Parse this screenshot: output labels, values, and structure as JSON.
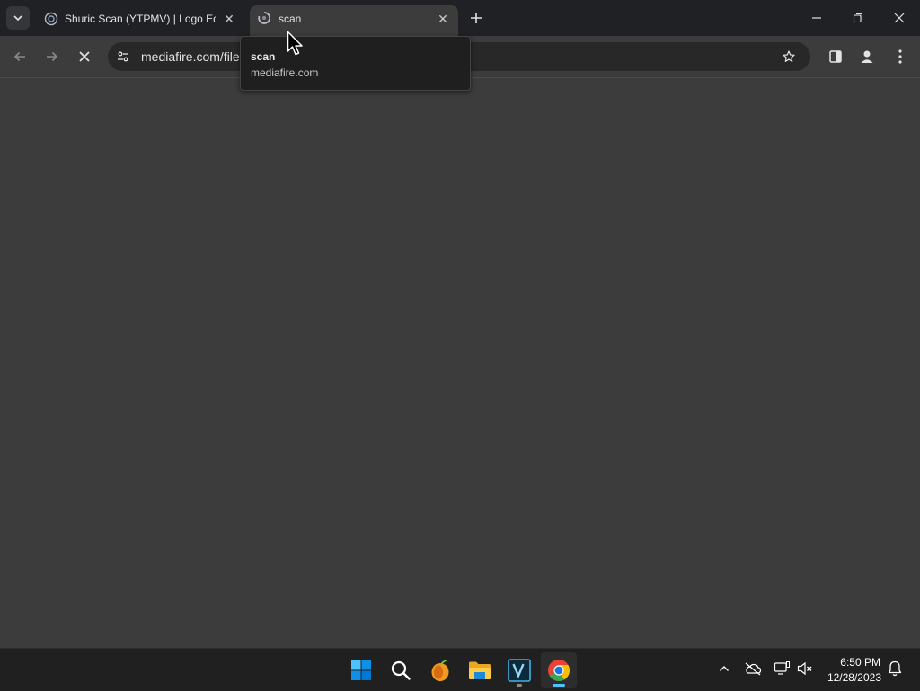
{
  "browser": {
    "tabs": [
      {
        "title": "Shuric Scan (YTPMV) | Logo Edi",
        "active": false
      },
      {
        "title": "scan",
        "active": true
      }
    ],
    "address": {
      "url": "mediafire.com/file"
    },
    "hover_card": {
      "title": "scan",
      "domain": "mediafire.com"
    }
  },
  "taskbar": {
    "apps": [
      "windows-start",
      "search",
      "fl-studio",
      "file-explorer",
      "vegas-pro",
      "google-chrome"
    ],
    "clock": {
      "time": "6:50 PM",
      "date": "12/28/2023"
    }
  },
  "colors": {
    "tab_strip": "#202124",
    "toolbar": "#3c3c3c",
    "page": "#3c3c3c",
    "taskbar": "#202020",
    "chrome_indicator": "#4cc2ff"
  }
}
